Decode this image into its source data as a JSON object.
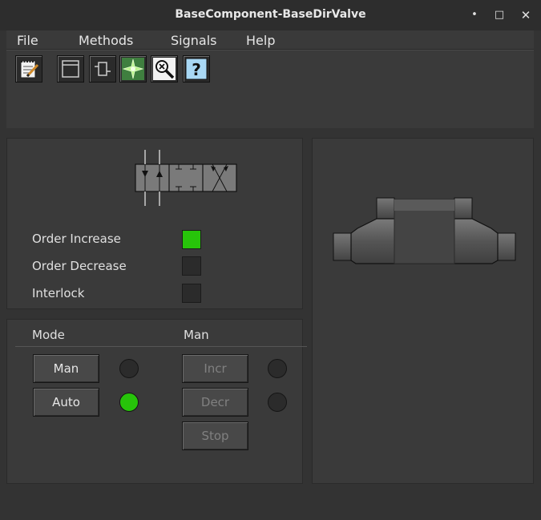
{
  "window": {
    "title": "BaseComponent-BaseDirValve",
    "minimize_glyph": "•",
    "maximize_glyph": "□",
    "close_glyph": "✕"
  },
  "menu": {
    "file": "File",
    "methods": "Methods",
    "signals": "Signals",
    "help": "Help"
  },
  "toolbar": {
    "icons": [
      "notepad-icon",
      "window-icon",
      "component-icon",
      "trace-icon",
      "crossref-icon",
      "help-icon"
    ],
    "help_glyph": "?"
  },
  "status": {
    "order_increase": {
      "label": "Order Increase",
      "on": true,
      "color": "#27c40a"
    },
    "order_decrease": {
      "label": "Order Decrease",
      "on": false
    },
    "interlock": {
      "label": "Interlock",
      "on": false
    }
  },
  "mode": {
    "mode_heading": "Mode",
    "mode_value": "Man",
    "man_label": "Man",
    "auto_label": "Auto",
    "man_led_on": false,
    "auto_led_on": true,
    "incr_label": "Incr",
    "decr_label": "Decr",
    "stop_label": "Stop"
  }
}
